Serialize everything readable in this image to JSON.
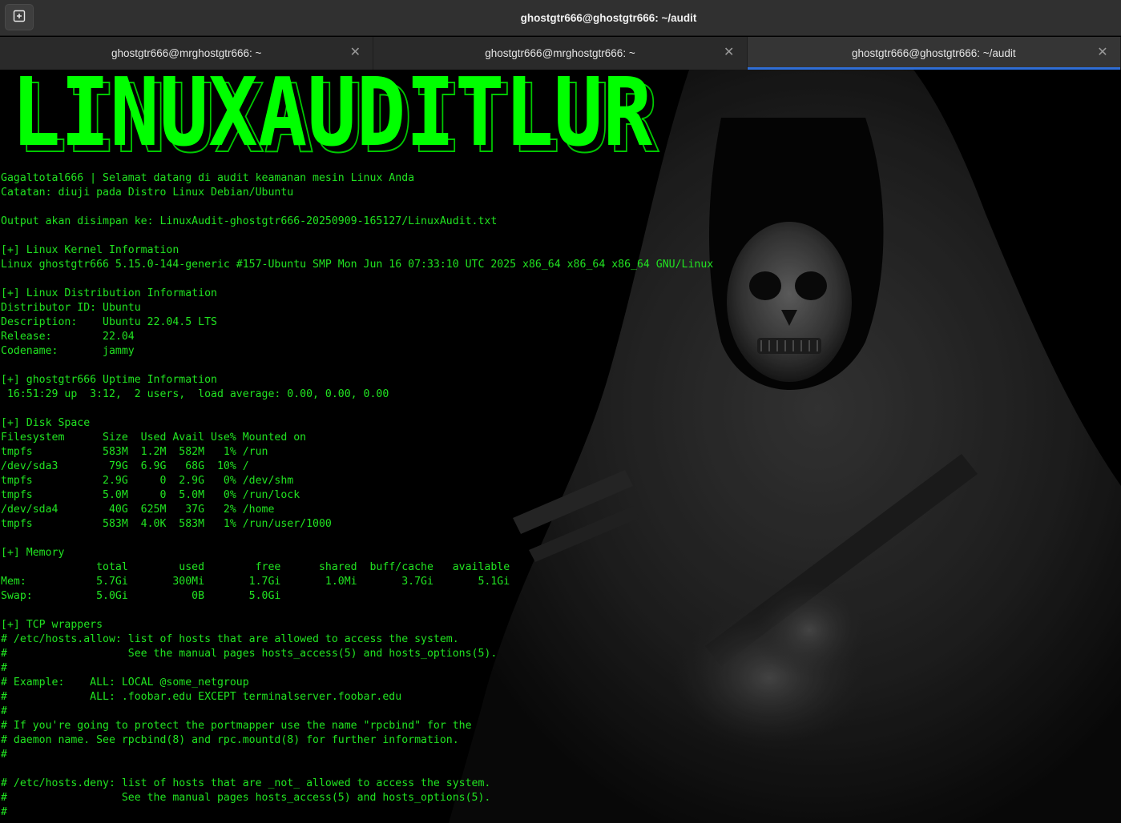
{
  "window": {
    "title": "ghostgtr666@ghostgtr666: ~/audit",
    "new_tab_icon": "new-tab-icon"
  },
  "tabs": [
    {
      "label": "ghostgtr666@mrghostgtr666: ~",
      "active": false
    },
    {
      "label": "ghostgtr666@mrghostgtr666: ~",
      "active": false
    },
    {
      "label": "ghostgtr666@ghostgtr666: ~/audit",
      "active": true
    }
  ],
  "banner": {
    "text": "LINUXAUDITLUR",
    "color": "#00ff00"
  },
  "colors": {
    "terminal_text": "#21e321",
    "accent": "#2f6ed6",
    "titlebar": "#303030"
  },
  "output": [
    "Gagaltotal666 | Selamat datang di audit keamanan mesin Linux Anda",
    "Catatan: diuji pada Distro Linux Debian/Ubuntu",
    "",
    "Output akan disimpan ke: LinuxAudit-ghostgtr666-20250909-165127/LinuxAudit.txt",
    "",
    "[+] Linux Kernel Information",
    "Linux ghostgtr666 5.15.0-144-generic #157-Ubuntu SMP Mon Jun 16 07:33:10 UTC 2025 x86_64 x86_64 x86_64 GNU/Linux",
    "",
    "[+] Linux Distribution Information",
    "Distributor ID: Ubuntu",
    "Description:    Ubuntu 22.04.5 LTS",
    "Release:        22.04",
    "Codename:       jammy",
    "",
    "[+] ghostgtr666 Uptime Information",
    " 16:51:29 up  3:12,  2 users,  load average: 0.00, 0.00, 0.00",
    "",
    "[+] Disk Space",
    "Filesystem      Size  Used Avail Use% Mounted on",
    "tmpfs           583M  1.2M  582M   1% /run",
    "/dev/sda3        79G  6.9G   68G  10% /",
    "tmpfs           2.9G     0  2.9G   0% /dev/shm",
    "tmpfs           5.0M     0  5.0M   0% /run/lock",
    "/dev/sda4        40G  625M   37G   2% /home",
    "tmpfs           583M  4.0K  583M   1% /run/user/1000",
    "",
    "[+] Memory",
    "               total        used        free      shared  buff/cache   available",
    "Mem:           5.7Gi       300Mi       1.7Gi       1.0Mi       3.7Gi       5.1Gi",
    "Swap:          5.0Gi          0B       5.0Gi",
    "",
    "[+] TCP wrappers",
    "# /etc/hosts.allow: list of hosts that are allowed to access the system.",
    "#                   See the manual pages hosts_access(5) and hosts_options(5).",
    "#",
    "# Example:    ALL: LOCAL @some_netgroup",
    "#             ALL: .foobar.edu EXCEPT terminalserver.foobar.edu",
    "#",
    "# If you're going to protect the portmapper use the name \"rpcbind\" for the",
    "# daemon name. See rpcbind(8) and rpc.mountd(8) for further information.",
    "#",
    "",
    "# /etc/hosts.deny: list of hosts that are _not_ allowed to access the system.",
    "#                  See the manual pages hosts_access(5) and hosts_options(5).",
    "#"
  ]
}
